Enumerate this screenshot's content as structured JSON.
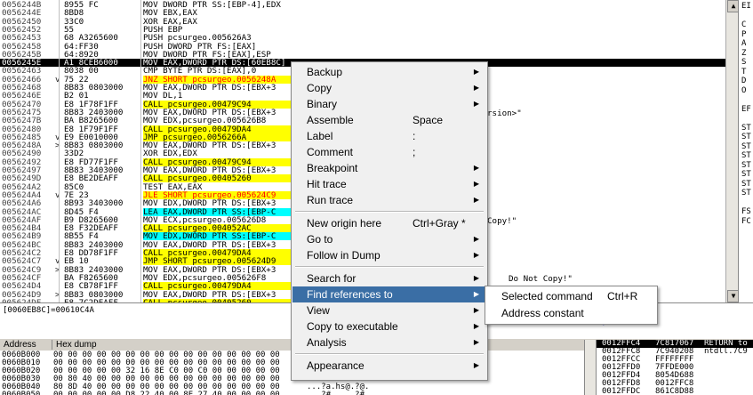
{
  "cpu_rows": [
    {
      "addr": "0056244B",
      "jm": "",
      "hex": "8955 FC",
      "dis": "MOV DWORD PTR SS:[EBP-4],EDX",
      "style": ""
    },
    {
      "addr": "0056244E",
      "jm": "",
      "hex": "8BD8",
      "dis": "MOV EBX,EAX",
      "style": ""
    },
    {
      "addr": "00562450",
      "jm": "",
      "hex": "33C0",
      "dis": "XOR EAX,EAX",
      "style": ""
    },
    {
      "addr": "00562452",
      "jm": "",
      "hex": "55",
      "dis": "PUSH EBP",
      "style": ""
    },
    {
      "addr": "00562453",
      "jm": "",
      "hex": "68 A3265600",
      "dis": "PUSH pcsurgeo.005626A3",
      "style": ""
    },
    {
      "addr": "00562458",
      "jm": "",
      "hex": "64:FF30",
      "dis": "PUSH DWORD PTR FS:[EAX]",
      "style": ""
    },
    {
      "addr": "0056245B",
      "jm": "",
      "hex": "64:8920",
      "dis": "MOV DWORD PTR FS:[EAX],ESP",
      "style": ""
    },
    {
      "addr": "0056245E",
      "jm": "",
      "hex": "A1 8CEB6000",
      "dis": "MOV EAX,DWORD PTR DS:[60EB8C]",
      "style": "sel"
    },
    {
      "addr": "00562463",
      "jm": "",
      "hex": "8038 00",
      "dis": "CMP BYTE PTR DS:[EAX],0",
      "style": ""
    },
    {
      "addr": "00562466",
      "jm": "v",
      "hex": "75 22",
      "dis": "JNZ SHORT pcsurgeo.0056248A",
      "style": "hlr"
    },
    {
      "addr": "00562468",
      "jm": "",
      "hex": "8B83 0803000",
      "dis": "MOV EAX,DWORD PTR DS:[EBX+3",
      "style": ""
    },
    {
      "addr": "0056246E",
      "jm": "",
      "hex": "B2 01",
      "dis": "MOV DL,1",
      "style": ""
    },
    {
      "addr": "00562470",
      "jm": "",
      "hex": "E8 1F78F1FF",
      "dis": "CALL pcsurgeo.00479C94",
      "style": "hl"
    },
    {
      "addr": "00562475",
      "jm": "",
      "hex": "8B83 2403000",
      "dis": "MOV EAX,DWORD PTR DS:[EBX+3",
      "style": ""
    },
    {
      "addr": "0056247B",
      "jm": "",
      "hex": "BA B8265600",
      "dis": "MOV EDX,pcsurgeo.005626B8",
      "style": ""
    },
    {
      "addr": "00562480",
      "jm": "",
      "hex": "E8 1F79F1FF",
      "dis": "CALL pcsurgeo.00479DA4",
      "style": "hl"
    },
    {
      "addr": "00562485",
      "jm": "v",
      "hex": "E9 E0010000",
      "dis": "JMP pcsurgeo.0056266A",
      "style": "hl"
    },
    {
      "addr": "0056248A",
      "jm": ">",
      "hex": "8B83 0803000",
      "dis": "MOV EAX,DWORD PTR DS:[EBX+3",
      "style": ""
    },
    {
      "addr": "00562490",
      "jm": "",
      "hex": "33D2",
      "dis": "XOR EDX,EDX",
      "style": ""
    },
    {
      "addr": "00562492",
      "jm": "",
      "hex": "E8 FD77F1FF",
      "dis": "CALL pcsurgeo.00479C94",
      "style": "hl"
    },
    {
      "addr": "00562497",
      "jm": "",
      "hex": "8B83 3403000",
      "dis": "MOV EAX,DWORD PTR DS:[EBX+3",
      "style": ""
    },
    {
      "addr": "0056249D",
      "jm": "",
      "hex": "E8 BE2DEAFF",
      "dis": "CALL pcsurgeo.00405260",
      "style": "hl"
    },
    {
      "addr": "005624A2",
      "jm": "",
      "hex": "85C0",
      "dis": "TEST EAX,EAX",
      "style": ""
    },
    {
      "addr": "005624A4",
      "jm": "v",
      "hex": "7E 23",
      "dis": "JLE SHORT pcsurgeo.005624C9",
      "style": "hlr"
    },
    {
      "addr": "005624A6",
      "jm": "",
      "hex": "8B93 3403000",
      "dis": "MOV EDX,DWORD PTR DS:[EBX+3",
      "style": ""
    },
    {
      "addr": "005624AC",
      "jm": "",
      "hex": "8D45 F4",
      "dis": "LEA EAX,DWORD PTR SS:[EBP-C",
      "style": "hlb"
    },
    {
      "addr": "005624AF",
      "jm": "",
      "hex": "B9 D8265600",
      "dis": "MOV ECX,pcsurgeo.005626D8",
      "style": ""
    },
    {
      "addr": "005624B4",
      "jm": "",
      "hex": "E8 F32DEAFF",
      "dis": "CALL pcsurgeo.004052AC",
      "style": "hl"
    },
    {
      "addr": "005624B9",
      "jm": "",
      "hex": "8B55 F4",
      "dis": "MOV EDX,DWORD PTR SS:[EBP-C",
      "style": "hlb"
    },
    {
      "addr": "005624BC",
      "jm": "",
      "hex": "8B83 2403000",
      "dis": "MOV EAX,DWORD PTR DS:[EBX+3",
      "style": ""
    },
    {
      "addr": "005624C2",
      "jm": "",
      "hex": "E8 DD78F1FF",
      "dis": "CALL pcsurgeo.00479DA4",
      "style": "hl"
    },
    {
      "addr": "005624C7",
      "jm": "v",
      "hex": "EB 10",
      "dis": "JMP SHORT pcsurgeo.005624D9",
      "style": "hl"
    },
    {
      "addr": "005624C9",
      "jm": ">",
      "hex": "8B83 2403000",
      "dis": "MOV EAX,DWORD PTR DS:[EBX+3",
      "style": ""
    },
    {
      "addr": "005624CF",
      "jm": "",
      "hex": "BA F8265600",
      "dis": "MOV EDX,pcsurgeo.005626F8",
      "style": ""
    },
    {
      "addr": "005624D4",
      "jm": "",
      "hex": "E8 CB78F1FF",
      "dis": "CALL pcsurgeo.00479DA4",
      "style": "hl"
    },
    {
      "addr": "005624D9",
      "jm": ">",
      "hex": "8B83 0803000",
      "dis": "MOV EAX,DWORD PTR DS:[EBX+3",
      "style": ""
    },
    {
      "addr": "005624DF",
      "jm": "",
      "hex": "E8 7C2DEAFF",
      "dis": "CALL pcsurgeo.00405260",
      "style": "hl"
    },
    {
      "addr": "005624E4",
      "jm": "",
      "hex": "85C0",
      "dis": "TEST EAX,EAX",
      "style": ""
    }
  ],
  "comment_fragments": [
    {
      "text": "rsion>\"",
      "row": 13
    },
    {
      "text": "Copy!\"",
      "row": 26
    },
    {
      "text": "Do Not Copy!\"",
      "row": 33
    }
  ],
  "register_letters": [
    "EI",
    "",
    "C",
    "P",
    "A",
    "Z",
    "S",
    "T",
    "D",
    "O",
    "",
    "EF",
    "",
    "ST",
    "ST",
    "ST",
    "ST",
    "ST",
    "ST",
    "ST",
    "ST",
    "",
    "FS",
    "FC"
  ],
  "info_text": "[0060EB8C]=00610C4A",
  "dump_header": {
    "address": "Address",
    "hex": "Hex dump"
  },
  "dump_rows": [
    {
      "addr": "0060B000",
      "hex": "00 00 00 00 00 00 00 00 00 00 00 00 00 00 00 00",
      "asc": ""
    },
    {
      "addr": "0060B010",
      "hex": "00 00 00 00 00 00 00 00 00 00 00 00 00 00 00 00",
      "asc": ""
    },
    {
      "addr": "0060B020",
      "hex": "00 00 00 00 00 32 16 8E C0 00 C0 00 00 00 00 00",
      "asc": ""
    },
    {
      "addr": "0060B030",
      "hex": "00 80 40 00 00 00 00 00 00 00 00 00 00 00 00 00",
      "asc": ""
    },
    {
      "addr": "0060B040",
      "hex": "80 8D 40 00 00 00 00 00 00 00 00 00 00 00 00 00",
      "asc": "...?a.hs@.?@."
    },
    {
      "addr": "0060B050",
      "hex": "00 00 00 00 00 D8 22 40 00 8E 27 40 00 00 00 00",
      "asc": "...?#.....?#."
    }
  ],
  "stack_rows": [
    {
      "addr": "0012FFC4",
      "val": "7C817067",
      "cmt": "RETURN to",
      "sel": true
    },
    {
      "addr": "0012FFC8",
      "val": "7C940208",
      "cmt": "ntdll.7C9",
      "sel": false
    },
    {
      "addr": "0012FFCC",
      "val": "FFFFFFFF",
      "cmt": "",
      "sel": false
    },
    {
      "addr": "0012FFD0",
      "val": "7FFDE000",
      "cmt": "",
      "sel": false
    },
    {
      "addr": "0012FFD4",
      "val": "8054D688",
      "cmt": "",
      "sel": false
    },
    {
      "addr": "0012FFD8",
      "val": "0012FFC8",
      "cmt": "",
      "sel": false
    },
    {
      "addr": "0012FFDC",
      "val": "861C8D88",
      "cmt": "",
      "sel": false
    }
  ],
  "menu": {
    "items": [
      {
        "label": "Backup",
        "shortcut": "",
        "arrow": true
      },
      {
        "label": "Copy",
        "shortcut": "",
        "arrow": true
      },
      {
        "label": "Binary",
        "shortcut": "",
        "arrow": true
      },
      {
        "label": "Assemble",
        "shortcut": "Space",
        "arrow": false
      },
      {
        "label": "Label",
        "shortcut": ":",
        "arrow": false
      },
      {
        "label": "Comment",
        "shortcut": ";",
        "arrow": false
      },
      {
        "label": "Breakpoint",
        "shortcut": "",
        "arrow": true
      },
      {
        "label": "Hit trace",
        "shortcut": "",
        "arrow": true
      },
      {
        "label": "Run trace",
        "shortcut": "",
        "arrow": true
      },
      {
        "sep": true
      },
      {
        "label": "New origin here",
        "shortcut": "Ctrl+Gray *",
        "arrow": false
      },
      {
        "label": "Go to",
        "shortcut": "",
        "arrow": true
      },
      {
        "label": "Follow in Dump",
        "shortcut": "",
        "arrow": true
      },
      {
        "sep": true
      },
      {
        "label": "Search for",
        "shortcut": "",
        "arrow": true
      },
      {
        "label": "Find references to",
        "shortcut": "",
        "arrow": true,
        "active": true
      },
      {
        "label": "View",
        "shortcut": "",
        "arrow": true
      },
      {
        "label": "Copy to executable",
        "shortcut": "",
        "arrow": true
      },
      {
        "label": "Analysis",
        "shortcut": "",
        "arrow": true
      },
      {
        "sep": true
      },
      {
        "label": "Appearance",
        "shortcut": "",
        "arrow": true
      }
    ]
  },
  "submenu": {
    "items": [
      {
        "label": "Selected command",
        "shortcut": "Ctrl+R"
      },
      {
        "label": "Address constant",
        "shortcut": ""
      }
    ]
  },
  "colors": {
    "menu_active": "#3a6ea5",
    "call_highlight": "#ffff00",
    "sel_row": "#000000",
    "check_mark": "#1a2fd6"
  }
}
